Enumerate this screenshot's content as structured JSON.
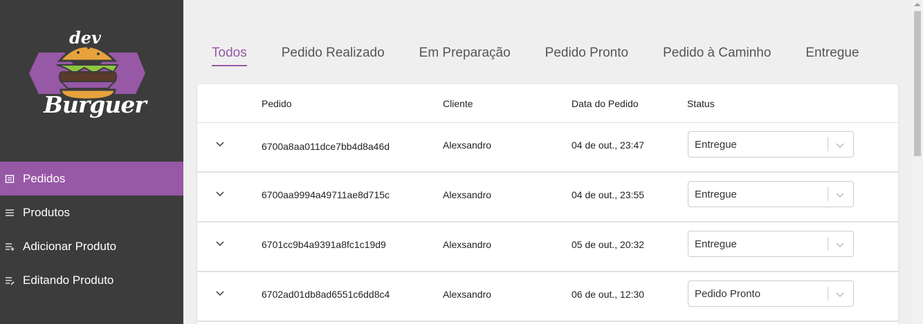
{
  "logo": {
    "line1": "dev",
    "line2": "Burguer"
  },
  "sidebar": {
    "items": [
      {
        "label": "Pedidos",
        "icon": "receipt-icon",
        "active": true
      },
      {
        "label": "Produtos",
        "icon": "list-icon",
        "active": false
      },
      {
        "label": "Adicionar Produto",
        "icon": "playlist-add-icon",
        "active": false
      },
      {
        "label": "Editando Produto",
        "icon": "playlist-edit-icon",
        "active": false
      }
    ]
  },
  "tabs": [
    {
      "label": "Todos",
      "active": true
    },
    {
      "label": "Pedido Realizado",
      "active": false
    },
    {
      "label": "Em Preparação",
      "active": false
    },
    {
      "label": "Pedido Pronto",
      "active": false
    },
    {
      "label": "Pedido à Caminho",
      "active": false
    },
    {
      "label": "Entregue",
      "active": false
    }
  ],
  "table": {
    "headers": {
      "order": "Pedido",
      "client": "Cliente",
      "date": "Data do Pedido",
      "status": "Status"
    },
    "rows": [
      {
        "order": "6700a8aa011dce7bb4d8a46d",
        "client": "Alexsandro",
        "date": "04 de out., 23:47",
        "status": "Entregue"
      },
      {
        "order": "6700aa9994a49711ae8d715c",
        "client": "Alexsandro",
        "date": "04 de out., 23:55",
        "status": "Entregue"
      },
      {
        "order": "6701cc9b4a9391a8fc1c19d9",
        "client": "Alexsandro",
        "date": "05 de out., 20:32",
        "status": "Entregue"
      },
      {
        "order": "6702ad01db8ad6551c6dd8c4",
        "client": "Alexsandro",
        "date": "06 de out., 12:30",
        "status": "Pedido Pronto"
      }
    ]
  },
  "colors": {
    "accent": "#9758a6",
    "sidebar_bg": "#3c3c3c",
    "page_bg": "#efefef"
  }
}
